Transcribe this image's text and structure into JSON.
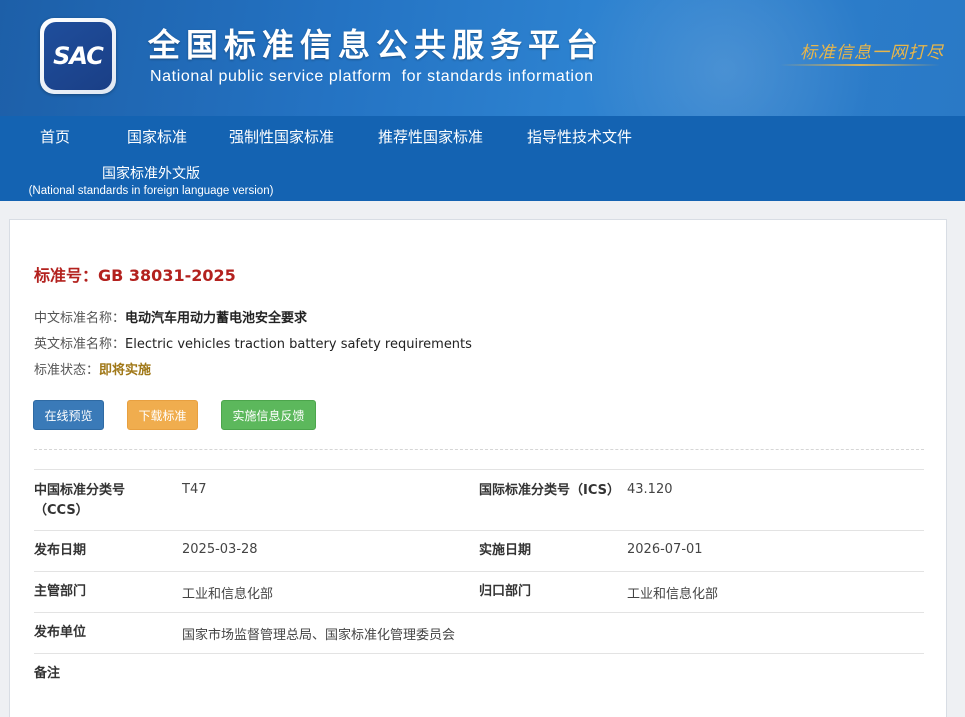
{
  "header": {
    "logo_text": "SAC",
    "title": "全国标准信息公共服务平台",
    "subtitle": "National public service platform  for standards information",
    "slogan": "标准信息一网打尽"
  },
  "nav": {
    "items": [
      "首页",
      "国家标准",
      "强制性国家标准",
      "推荐性国家标准",
      "指导性技术文件"
    ],
    "foreign_cn": "国家标准外文版",
    "foreign_en": "(National standards in foreign language version)"
  },
  "standard": {
    "number_label": "标准号：",
    "number": "GB 38031-2025",
    "cn_name_label": "中文标准名称：",
    "cn_name": "电动汽车用动力蓄电池安全要求",
    "en_name_label": "英文标准名称：",
    "en_name": "Electric vehicles traction battery safety requirements",
    "status_label": "标准状态：",
    "status": "即将实施"
  },
  "buttons": {
    "preview": "在线预览",
    "download": "下载标准",
    "feedback": "实施信息反馈"
  },
  "details": {
    "ccs_label_1": "中国标准分类号",
    "ccs_label_2": "（CCS）",
    "ccs": "T47",
    "ics_label": "国际标准分类号（ICS）",
    "ics": "43.120",
    "publish_date_label": "发布日期",
    "publish_date": "2025-03-28",
    "impl_date_label": "实施日期",
    "impl_date": "2026-07-01",
    "authority_label": "主管部门",
    "authority": "工业和信息化部",
    "centralized_label": "归口部门",
    "centralized": "工业和信息化部",
    "issuer_label": "发布单位",
    "issuer": "国家市场监督管理总局、国家标准化管理委员会",
    "remarks_label": "备注",
    "remarks": ""
  },
  "colors": {
    "header_blue": "#2473c3",
    "nav_blue": "#1463b2",
    "std_no_red": "#b3211e",
    "status_gold": "#a07818",
    "btn_preview": "#3a7ab8",
    "btn_download": "#f0ad4e",
    "btn_feedback": "#5cb85c"
  }
}
